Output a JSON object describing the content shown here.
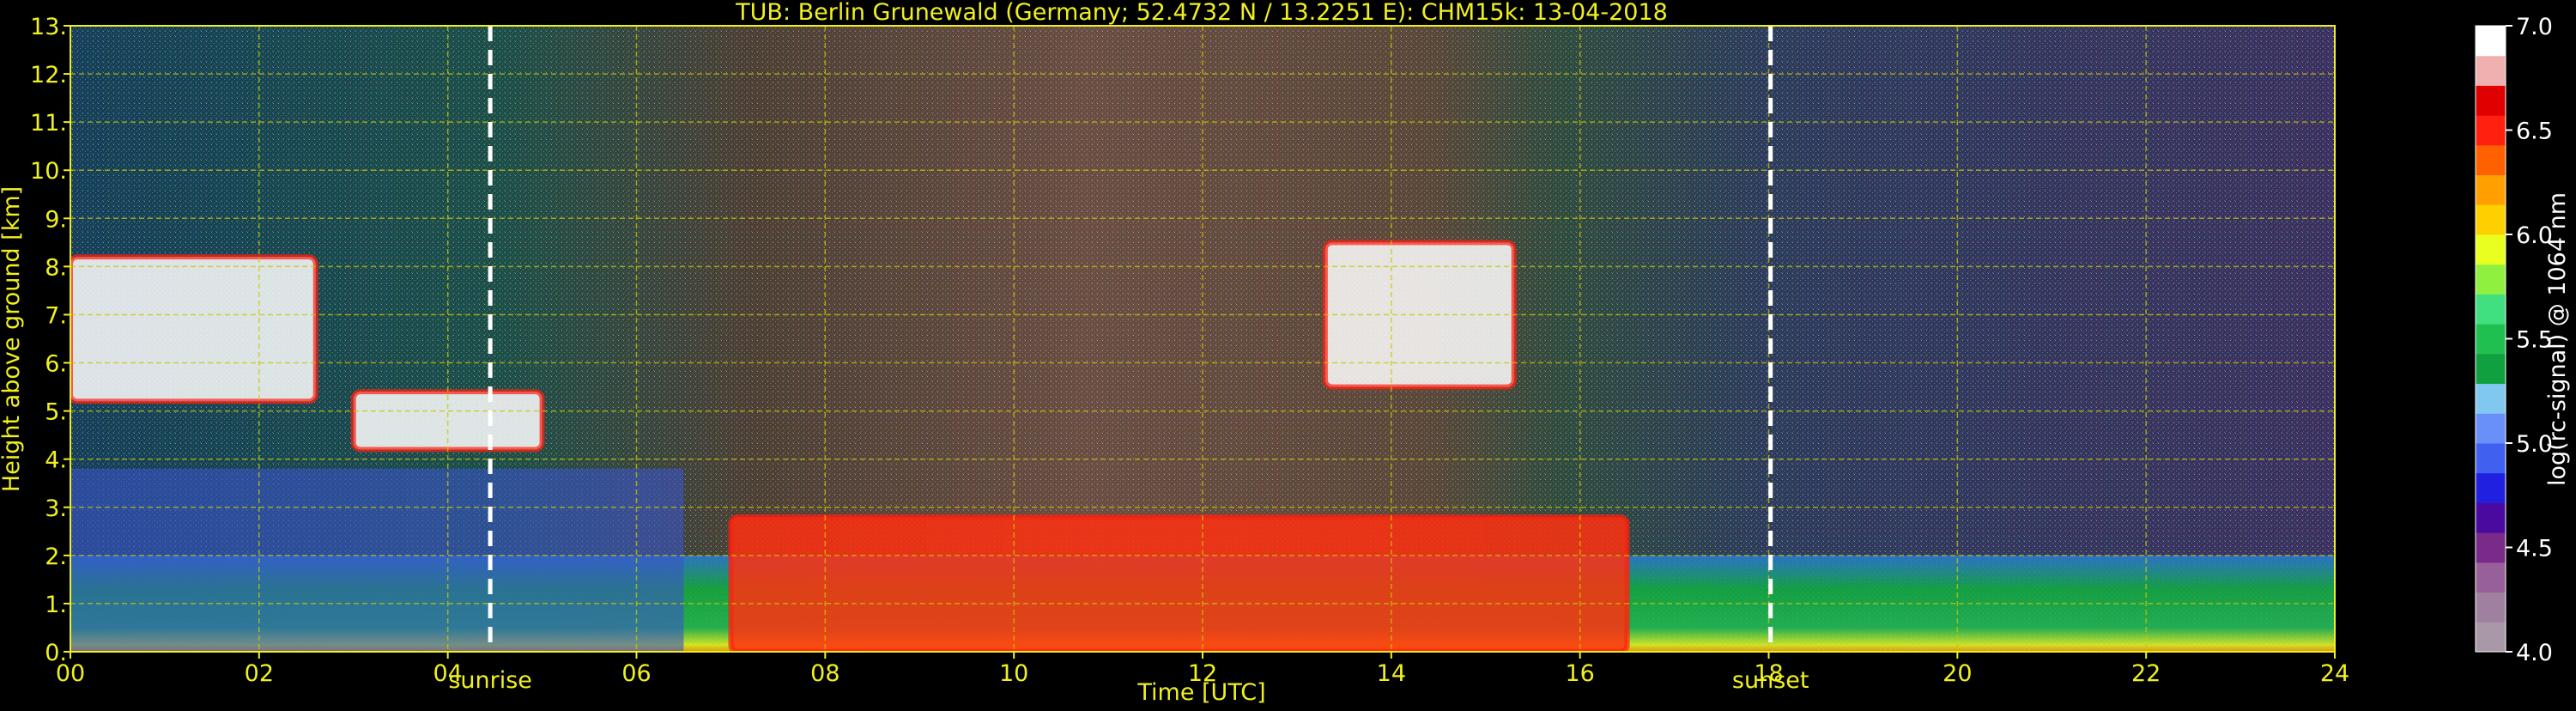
{
  "chart_data": {
    "type": "heatmap",
    "title": "TUB: Berlin Grunewald (Germany; 52.4732 N / 13.2251 E):    CHM15k: 13-04-2018",
    "xlabel": "Time [UTC]",
    "ylabel": "Height above ground [km]",
    "xlim": [
      0,
      24
    ],
    "ylim": [
      0,
      13
    ],
    "x_ticks": [
      0,
      2,
      4,
      6,
      8,
      10,
      12,
      14,
      16,
      18,
      20,
      22,
      24
    ],
    "x_tick_labels": [
      "00",
      "02",
      "04",
      "06",
      "08",
      "10",
      "12",
      "14",
      "16",
      "18",
      "20",
      "22",
      "24"
    ],
    "y_ticks": [
      0,
      1,
      2,
      3,
      4,
      5,
      6,
      7,
      8,
      9,
      10,
      11,
      12,
      13
    ],
    "y_tick_labels": [
      "0.",
      "1.",
      "2.",
      "3.",
      "4.",
      "5.",
      "6.",
      "7.",
      "8.",
      "9.",
      "10.",
      "11.",
      "12.",
      "13."
    ],
    "grid": true,
    "markers": [
      {
        "label": "sunrise",
        "x": 4.45
      },
      {
        "label": "sunset",
        "x": 18.02
      }
    ],
    "colorbar": {
      "label": "log(rc-signal) @ 1064 nm",
      "range": [
        4.0,
        7.0
      ],
      "ticks": [
        4.0,
        4.5,
        5.0,
        5.5,
        6.0,
        6.5,
        7.0
      ],
      "tick_labels": [
        "4.0",
        "4.5",
        "5.0",
        "5.5",
        "6.0",
        "6.5",
        "7.0"
      ],
      "colors": [
        "#a898a8",
        "#a080a0",
        "#98609a",
        "#7a2a88",
        "#4a0aa0",
        "#2020e0",
        "#4060f0",
        "#6890f8",
        "#80c8f0",
        "#10a040",
        "#20c050",
        "#40e080",
        "#90f040",
        "#e8ff20",
        "#ffd000",
        "#ffa000",
        "#ff6000",
        "#ff2010",
        "#e00000",
        "#f0b0b0",
        "#ffffff"
      ]
    },
    "features": [
      {
        "kind": "boundary_layer",
        "x_start": 0,
        "x_end": 24,
        "top_km": 2.0
      },
      {
        "kind": "residual_layer",
        "x_start": 0,
        "x_end": 6.5,
        "top_km": 3.8
      },
      {
        "kind": "cloud_layer",
        "x_start": 3.0,
        "x_end": 5.0,
        "y_range_km": [
          4.2,
          5.4
        ]
      },
      {
        "kind": "cloud_layer",
        "x_start": 0,
        "x_end": 2.6,
        "y_range_km": [
          5.2,
          8.2
        ]
      },
      {
        "kind": "low_cloud_convection",
        "x_start": 7.0,
        "x_end": 16.5,
        "y_range_km": [
          0,
          2.8
        ]
      },
      {
        "kind": "high_cloud",
        "x_start": 13.3,
        "x_end": 15.3,
        "y_range_km": [
          5.5,
          8.5
        ]
      }
    ],
    "legend": "colorbar-right"
  }
}
